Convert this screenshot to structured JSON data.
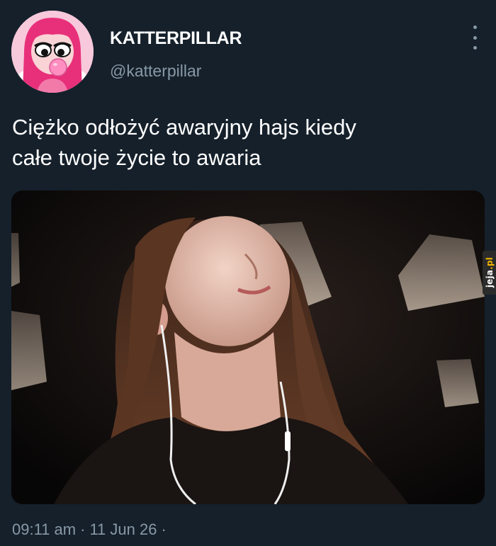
{
  "user": {
    "display_name": "KATTERPILLAR",
    "handle": "@katterpillar",
    "avatar_icon": "cartoon-avatar-pink-hair-bubblegum"
  },
  "tweet": {
    "text": "Ciężko odłożyć awaryjny hajs kiedy\ncałe twoje życie to awaria",
    "media_description_icon": "photo-girl-with-earphones",
    "time": "09:11 am",
    "date": "11 Jun 26",
    "separator": "·"
  },
  "watermark": {
    "text_main": "jeja",
    "text_dot": ".pl"
  },
  "colors": {
    "background": "#15202b",
    "secondary_text": "#8899a6",
    "primary_text": "#ffffff"
  }
}
